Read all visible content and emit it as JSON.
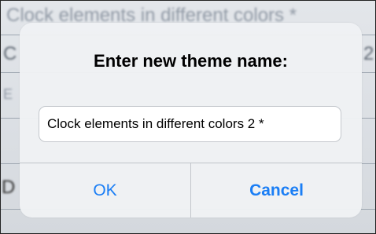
{
  "background": {
    "row1_text": "Clock elements in different colors *",
    "row2_text": "C",
    "row2_suffix": "2",
    "row3_text": "E",
    "row4_text": "D"
  },
  "dialog": {
    "title": "Enter new theme name:",
    "field_value": "Clock elements in different colors 2 *",
    "ok_label": "OK",
    "cancel_label": "Cancel"
  },
  "colors": {
    "accent": "#1a7ef5",
    "dialog_bg": "#eff1f4"
  }
}
